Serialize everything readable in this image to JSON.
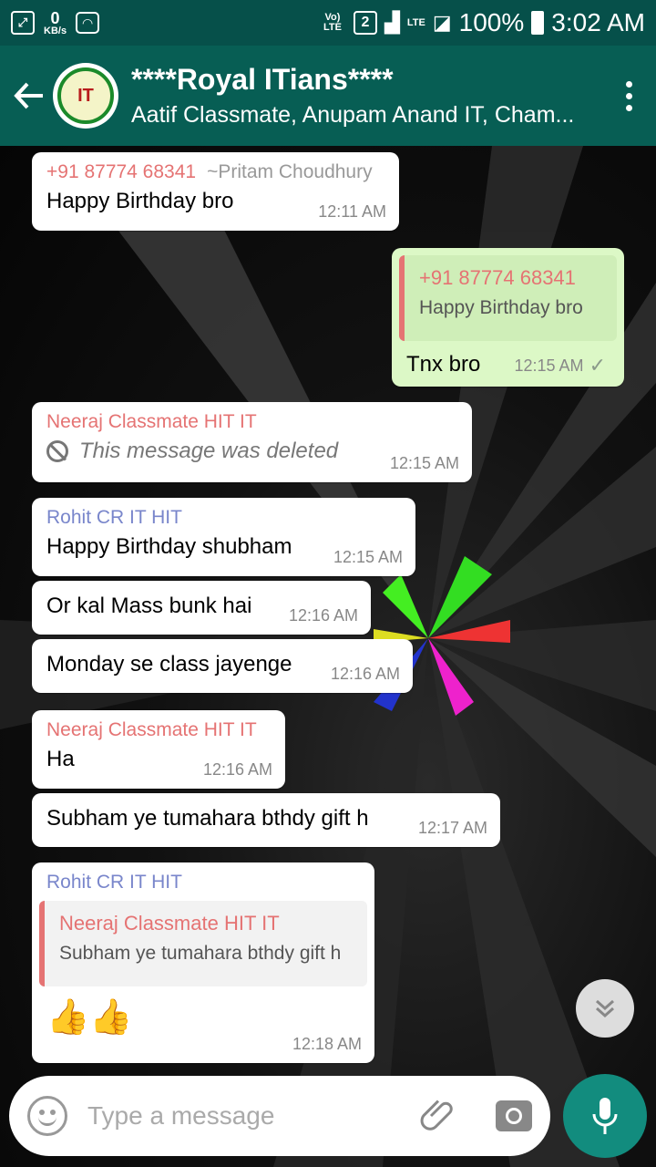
{
  "status_bar": {
    "speed_value": "0",
    "speed_unit": "KB/s",
    "sim_badge": "2",
    "network_1": "Vo) LTE",
    "network_2": "LTE",
    "battery": "100%",
    "time": "3:02 AM"
  },
  "header": {
    "title": "****Royal ITians****",
    "subtitle": "Aatif Classmate, Anupam Anand IT, Cham..."
  },
  "messages": [
    {
      "sender": "+91 87774 68341",
      "alias": "~Pritam Choudhury",
      "text": "Happy Birthday bro",
      "time": "12:11 AM"
    },
    {
      "quote_name": "+91 87774 68341",
      "quote_text": "Happy Birthday bro",
      "text": "Tnx bro",
      "time": "12:15 AM"
    },
    {
      "sender": "Neeraj Classmate HIT IT",
      "text": "This message was deleted",
      "time": "12:15 AM"
    },
    {
      "sender": "Rohit CR IT HIT",
      "text": "Happy Birthday shubham",
      "time": "12:15 AM"
    },
    {
      "text": "Or kal Mass bunk hai",
      "time": "12:16 AM"
    },
    {
      "text": "Monday se class jayenge",
      "time": "12:16 AM"
    },
    {
      "sender": "Neeraj Classmate HIT IT",
      "text": "Ha",
      "time": "12:16 AM"
    },
    {
      "text": "Subham ye tumahara bthdy  gift h",
      "time": "12:17 AM"
    },
    {
      "sender": "Rohit CR IT HIT",
      "quote_name": "Neeraj Classmate HIT IT",
      "quote_text": "Subham ye tumahara bthdy  gift h",
      "text": "👍👍",
      "time": "12:18 AM"
    }
  ],
  "composer": {
    "placeholder": "Type a message"
  },
  "icons": {
    "back": "arrow-left-icon",
    "menu": "more-vert-icon",
    "emoji": "emoji-icon",
    "attach": "paperclip-icon",
    "camera": "camera-icon",
    "mic": "mic-icon",
    "scroll": "chevron-double-down-icon",
    "deleted": "blocked-icon",
    "read": "check-icon"
  },
  "colors": {
    "header": "#075e54",
    "status_bar": "#06504a",
    "outgoing_bubble": "#dcf8c6",
    "accent": "#128c7e",
    "sender_red": "#e57373",
    "sender_blue": "#7986cb"
  }
}
